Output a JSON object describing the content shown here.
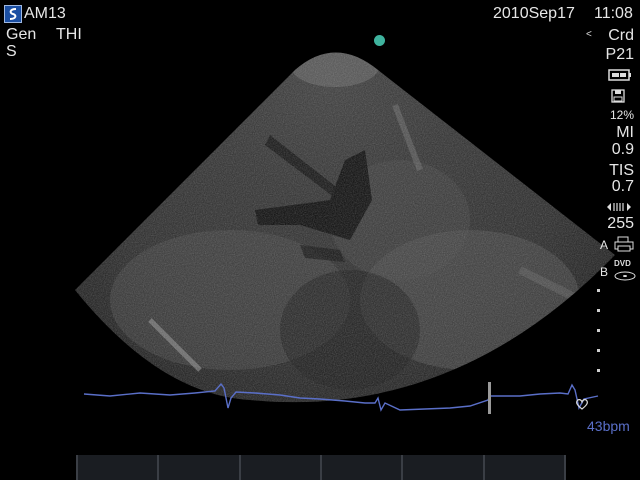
{
  "header": {
    "preset": "AM13",
    "mode_left": "Gen",
    "mode_right": "THI",
    "sub_mode": "S",
    "date": "2010Sep17",
    "time": "11:08"
  },
  "right_panel": {
    "exam_type": "Crd",
    "probe": "P21",
    "power": "12%",
    "mi_label": "MI",
    "mi_value": "0.9",
    "tis_label": "TIS",
    "tis_value": "0.7",
    "depth": "255",
    "printer_label": "A",
    "dvd_label": "B",
    "dvd_text": "DVD"
  },
  "ecg": {
    "heart_rate": "43bpm",
    "trace_color": "#5a6fc8"
  },
  "colors": {
    "orientation_marker": "#3fb39e",
    "heart_rate": "#5a6fc8"
  },
  "softkeys": [
    "",
    "",
    "",
    "",
    "",
    ""
  ]
}
